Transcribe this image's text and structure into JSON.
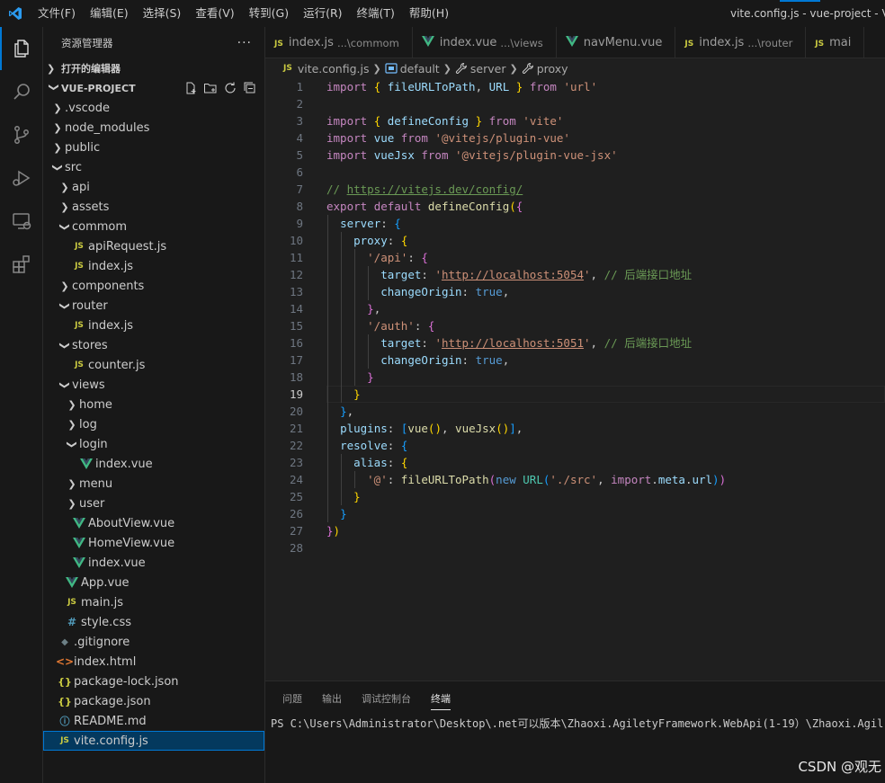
{
  "titlebar": {
    "menu": [
      "文件(F)",
      "编辑(E)",
      "选择(S)",
      "查看(V)",
      "转到(G)",
      "运行(R)",
      "终端(T)",
      "帮助(H)"
    ],
    "window_title": "vite.config.js - vue-project - Visu"
  },
  "sidebar": {
    "title": "资源管理器",
    "more": "···",
    "open_editors": "打开的编辑器",
    "project": "VUE-PROJECT",
    "tree": [
      {
        "label": ".vscode",
        "type": "folder",
        "depth": 1,
        "open": false
      },
      {
        "label": "node_modules",
        "type": "folder",
        "depth": 1,
        "open": false
      },
      {
        "label": "public",
        "type": "folder",
        "depth": 1,
        "open": false
      },
      {
        "label": "src",
        "type": "folder",
        "depth": 1,
        "open": true
      },
      {
        "label": "api",
        "type": "folder",
        "depth": 2,
        "open": false
      },
      {
        "label": "assets",
        "type": "folder",
        "depth": 2,
        "open": false
      },
      {
        "label": "commom",
        "type": "folder",
        "depth": 2,
        "open": true
      },
      {
        "label": "apiRequest.js",
        "type": "js",
        "depth": 3
      },
      {
        "label": "index.js",
        "type": "js",
        "depth": 3
      },
      {
        "label": "components",
        "type": "folder",
        "depth": 2,
        "open": false
      },
      {
        "label": "router",
        "type": "folder",
        "depth": 2,
        "open": true
      },
      {
        "label": "index.js",
        "type": "js",
        "depth": 3
      },
      {
        "label": "stores",
        "type": "folder",
        "depth": 2,
        "open": true
      },
      {
        "label": "counter.js",
        "type": "js",
        "depth": 3
      },
      {
        "label": "views",
        "type": "folder",
        "depth": 2,
        "open": true
      },
      {
        "label": "home",
        "type": "folder",
        "depth": 3,
        "open": false
      },
      {
        "label": "log",
        "type": "folder",
        "depth": 3,
        "open": false
      },
      {
        "label": "login",
        "type": "folder",
        "depth": 3,
        "open": true
      },
      {
        "label": "index.vue",
        "type": "vue",
        "depth": 4
      },
      {
        "label": "menu",
        "type": "folder",
        "depth": 3,
        "open": false
      },
      {
        "label": "user",
        "type": "folder",
        "depth": 3,
        "open": false
      },
      {
        "label": "AboutView.vue",
        "type": "vue",
        "depth": 3
      },
      {
        "label": "HomeView.vue",
        "type": "vue",
        "depth": 3
      },
      {
        "label": "index.vue",
        "type": "vue",
        "depth": 3
      },
      {
        "label": "App.vue",
        "type": "vue",
        "depth": 2
      },
      {
        "label": "main.js",
        "type": "js",
        "depth": 2
      },
      {
        "label": "style.css",
        "type": "css",
        "depth": 2
      },
      {
        "label": ".gitignore",
        "type": "git",
        "depth": 1
      },
      {
        "label": "index.html",
        "type": "html",
        "depth": 1
      },
      {
        "label": "package-lock.json",
        "type": "json",
        "depth": 1
      },
      {
        "label": "package.json",
        "type": "json",
        "depth": 1
      },
      {
        "label": "README.md",
        "type": "info",
        "depth": 1
      },
      {
        "label": "vite.config.js",
        "type": "js",
        "depth": 1,
        "selected": true
      }
    ]
  },
  "tabs": [
    {
      "label": "index.js",
      "desc": "...\\commom",
      "type": "js"
    },
    {
      "label": "index.vue",
      "desc": "...\\views",
      "type": "vue"
    },
    {
      "label": "navMenu.vue",
      "desc": "",
      "type": "vue"
    },
    {
      "label": "index.js",
      "desc": "...\\router",
      "type": "js"
    },
    {
      "label": "mai",
      "desc": "",
      "type": "js"
    }
  ],
  "breadcrumbs": [
    "vite.config.js",
    "default",
    "server",
    "proxy"
  ],
  "editor": {
    "current_line": 19,
    "lines": [
      [
        [
          "kw",
          "import"
        ],
        [
          "pl",
          " "
        ],
        [
          "p1",
          "{"
        ],
        [
          "pl",
          " "
        ],
        [
          "var",
          "fileURLToPath"
        ],
        [
          "pl",
          ", "
        ],
        [
          "var",
          "URL"
        ],
        [
          "pl",
          " "
        ],
        [
          "p1",
          "}"
        ],
        [
          "pl",
          " "
        ],
        [
          "kw",
          "from"
        ],
        [
          "pl",
          " "
        ],
        [
          "str",
          "'url'"
        ]
      ],
      [],
      [
        [
          "kw",
          "import"
        ],
        [
          "pl",
          " "
        ],
        [
          "p1",
          "{"
        ],
        [
          "pl",
          " "
        ],
        [
          "var",
          "defineConfig"
        ],
        [
          "pl",
          " "
        ],
        [
          "p1",
          "}"
        ],
        [
          "pl",
          " "
        ],
        [
          "kw",
          "from"
        ],
        [
          "pl",
          " "
        ],
        [
          "str",
          "'vite'"
        ]
      ],
      [
        [
          "kw",
          "import"
        ],
        [
          "pl",
          " "
        ],
        [
          "var",
          "vue"
        ],
        [
          "pl",
          " "
        ],
        [
          "kw",
          "from"
        ],
        [
          "pl",
          " "
        ],
        [
          "str",
          "'@vitejs/plugin-vue'"
        ]
      ],
      [
        [
          "kw",
          "import"
        ],
        [
          "pl",
          " "
        ],
        [
          "var",
          "vueJsx"
        ],
        [
          "pl",
          " "
        ],
        [
          "kw",
          "from"
        ],
        [
          "pl",
          " "
        ],
        [
          "str",
          "'@vitejs/plugin-vue-jsx'"
        ]
      ],
      [],
      [
        [
          "cm",
          "// "
        ],
        [
          "cmu",
          "https://vitejs.dev/config/"
        ]
      ],
      [
        [
          "kw",
          "export"
        ],
        [
          "pl",
          " "
        ],
        [
          "kw",
          "default"
        ],
        [
          "pl",
          " "
        ],
        [
          "fn",
          "defineConfig"
        ],
        [
          "p1",
          "("
        ],
        [
          "p2",
          "{"
        ]
      ],
      [
        [
          "pl",
          "  "
        ],
        [
          "var",
          "server"
        ],
        [
          "pl",
          ": "
        ],
        [
          "p3",
          "{"
        ]
      ],
      [
        [
          "pl",
          "    "
        ],
        [
          "var",
          "proxy"
        ],
        [
          "pl",
          ": "
        ],
        [
          "p1",
          "{"
        ]
      ],
      [
        [
          "pl",
          "      "
        ],
        [
          "str",
          "'/api'"
        ],
        [
          "pl",
          ": "
        ],
        [
          "p2",
          "{"
        ]
      ],
      [
        [
          "pl",
          "        "
        ],
        [
          "var",
          "target"
        ],
        [
          "pl",
          ": "
        ],
        [
          "str",
          "'"
        ],
        [
          "url",
          "http://localhost:5054"
        ],
        [
          "str",
          "'"
        ],
        [
          "pl",
          ", "
        ],
        [
          "cm",
          "// 后端接口地址"
        ]
      ],
      [
        [
          "pl",
          "        "
        ],
        [
          "var",
          "changeOrigin"
        ],
        [
          "pl",
          ": "
        ],
        [
          "kb",
          "true"
        ],
        [
          "pl",
          ","
        ]
      ],
      [
        [
          "pl",
          "      "
        ],
        [
          "p2",
          "}"
        ],
        [
          "pl",
          ","
        ]
      ],
      [
        [
          "pl",
          "      "
        ],
        [
          "str",
          "'/auth'"
        ],
        [
          "pl",
          ": "
        ],
        [
          "p2",
          "{"
        ]
      ],
      [
        [
          "pl",
          "        "
        ],
        [
          "var",
          "target"
        ],
        [
          "pl",
          ": "
        ],
        [
          "str",
          "'"
        ],
        [
          "url",
          "http://localhost:5051"
        ],
        [
          "str",
          "'"
        ],
        [
          "pl",
          ", "
        ],
        [
          "cm",
          "// 后端接口地址"
        ]
      ],
      [
        [
          "pl",
          "        "
        ],
        [
          "var",
          "changeOrigin"
        ],
        [
          "pl",
          ": "
        ],
        [
          "kb",
          "true"
        ],
        [
          "pl",
          ","
        ]
      ],
      [
        [
          "pl",
          "      "
        ],
        [
          "p2",
          "}"
        ]
      ],
      [
        [
          "pl",
          "    "
        ],
        [
          "p1",
          "}"
        ]
      ],
      [
        [
          "pl",
          "  "
        ],
        [
          "p3",
          "}"
        ],
        [
          "pl",
          ","
        ]
      ],
      [
        [
          "pl",
          "  "
        ],
        [
          "var",
          "plugins"
        ],
        [
          "pl",
          ": "
        ],
        [
          "p3",
          "["
        ],
        [
          "fn",
          "vue"
        ],
        [
          "p1",
          "()"
        ],
        [
          "pl",
          ", "
        ],
        [
          "fn",
          "vueJsx"
        ],
        [
          "p1",
          "()"
        ],
        [
          "p3",
          "]"
        ],
        [
          "pl",
          ","
        ]
      ],
      [
        [
          "pl",
          "  "
        ],
        [
          "var",
          "resolve"
        ],
        [
          "pl",
          ": "
        ],
        [
          "p3",
          "{"
        ]
      ],
      [
        [
          "pl",
          "    "
        ],
        [
          "var",
          "alias"
        ],
        [
          "pl",
          ": "
        ],
        [
          "p1",
          "{"
        ]
      ],
      [
        [
          "pl",
          "      "
        ],
        [
          "str",
          "'@'"
        ],
        [
          "pl",
          ": "
        ],
        [
          "fn",
          "fileURLToPath"
        ],
        [
          "p2",
          "("
        ],
        [
          "kb",
          "new"
        ],
        [
          "pl",
          " "
        ],
        [
          "cls",
          "URL"
        ],
        [
          "p3",
          "("
        ],
        [
          "str",
          "'./src'"
        ],
        [
          "pl",
          ", "
        ],
        [
          "kw",
          "import"
        ],
        [
          "pl",
          "."
        ],
        [
          "var",
          "meta"
        ],
        [
          "pl",
          "."
        ],
        [
          "var",
          "url"
        ],
        [
          "p3",
          ")"
        ],
        [
          "p2",
          ")"
        ]
      ],
      [
        [
          "pl",
          "    "
        ],
        [
          "p1",
          "}"
        ]
      ],
      [
        [
          "pl",
          "  "
        ],
        [
          "p3",
          "}"
        ]
      ],
      [
        [
          "p2",
          "}"
        ],
        [
          "p1",
          ")"
        ]
      ],
      []
    ]
  },
  "panel": {
    "tabs": [
      "问题",
      "输出",
      "调试控制台",
      "终端"
    ],
    "active_tab": 3,
    "terminal_line": "PS C:\\Users\\Administrator\\Desktop\\.net可以版本\\Zhaoxi.AgiletyFramework.WebApi(1-19）\\Zhaoxi.Agil"
  },
  "watermark": "CSDN @观无",
  "colors": {
    "accent": "#0078d4",
    "vue": "#41b883",
    "js": "#cbcb41",
    "editor_bg": "#1f1f1f",
    "sidebar_bg": "#181818"
  }
}
